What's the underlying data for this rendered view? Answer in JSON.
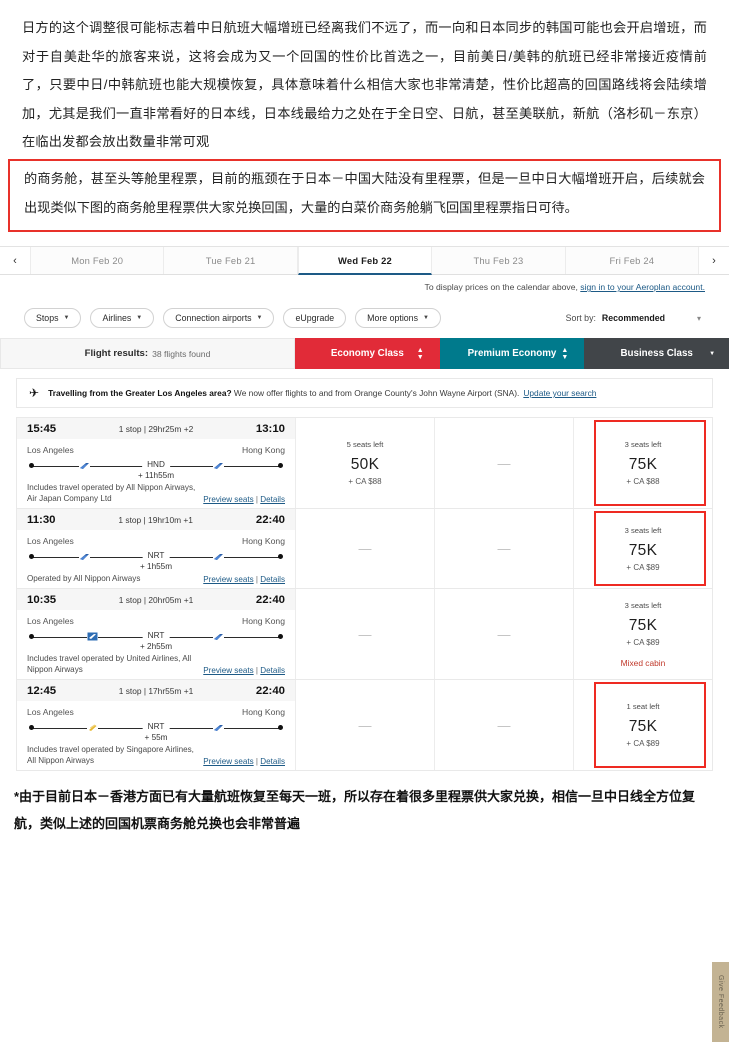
{
  "article": {
    "paragraph": "日方的这个调整很可能标志着中日航班大幅增班已经离我们不远了，而一向和日本同步的韩国可能也会开启增班，而对于自美赴华的旅客来说，这将会成为又一个回国的性价比首选之一，目前美日/美韩的航班已经非常接近疫情前了，只要中日/中韩航班也能大规模恢复，具体意味着什么相信大家也非常清楚，性价比超高的回国路线将会陆续增加，尤其是我们一直非常看好的日本线，日本线最给力之处在于全日空、日航，甚至美联航，新航（洛杉矶－东京）在临出发都会放出数量非常可观",
    "highlight": "的商务舱，甚至头等舱里程票，目前的瓶颈在于日本－中国大陆没有里程票，但是一旦中日大幅增班开启，后续就会出现类似下图的商务舱里程票供大家兑换回国，大量的白菜价商务舱躺飞回国里程票指日可待。",
    "footnote": "*由于目前日本－香港方面已有大量航班恢复至每天一班，所以存在着很多里程票供大家兑换，相信一旦中日线全方位复航，类似上述的回国机票商务舱兑换也会非常普遍"
  },
  "colors": {
    "economy": "#e12b38",
    "premium": "#007a8c",
    "business": "#414549",
    "link": "#1d5a86",
    "highlight_border": "#e8312a",
    "feedback_tab": "#c3b393"
  },
  "datebar": {
    "prev_icon": "‹",
    "next_icon": "›",
    "dates": [
      {
        "label": "Mon Feb 20",
        "active": false
      },
      {
        "label": "Tue Feb 21",
        "active": false
      },
      {
        "label": "Wed Feb 22",
        "active": true
      },
      {
        "label": "Thu Feb 23",
        "active": false
      },
      {
        "label": "Fri Feb 24",
        "active": false
      }
    ],
    "signin_text": "To display prices on the calendar above, ",
    "signin_link": "sign in to your Aeroplan account."
  },
  "filters": {
    "pills": [
      {
        "label": "Stops",
        "caret": true
      },
      {
        "label": "Airlines",
        "caret": true
      },
      {
        "label": "Connection airports",
        "caret": true
      },
      {
        "label": "eUpgrade",
        "caret": false
      },
      {
        "label": "More options",
        "caret": true
      }
    ],
    "sort_label": "Sort by:",
    "sort_value": "Recommended"
  },
  "results": {
    "title": "Flight results:",
    "count_text": "38 flights found",
    "cabins": [
      {
        "label": "Economy Class"
      },
      {
        "label": "Premium Economy"
      },
      {
        "label": "Business Class"
      }
    ]
  },
  "notice": {
    "icon": "airplane-icon",
    "bold": "Travelling from the Greater Los Angeles area?",
    "text": " We now offer flights to and from Orange County's John Wayne Airport (SNA).",
    "link": "Update your search"
  },
  "flights": [
    {
      "depart_time": "15:45",
      "summary": "1 stop | 29hr25m +2",
      "arrive_time": "13:10",
      "origin": "Los Angeles",
      "destination": "Hong Kong",
      "connection": "HND",
      "layover": "+ 11h55m",
      "operated_by": "Includes travel operated by All Nippon Airways, Air Japan Company Ltd",
      "preview_link": "Preview seats",
      "details_link": "Details",
      "economy": {
        "seats": "5 seats left",
        "miles": "50K",
        "cash": "+ CA $88",
        "empty": false,
        "highlight": false,
        "mixed": ""
      },
      "premium": {
        "empty": true,
        "dash": "—"
      },
      "business": {
        "seats": "3 seats left",
        "miles": "75K",
        "cash": "+ CA $88",
        "empty": false,
        "highlight": true,
        "mixed": ""
      }
    },
    {
      "depart_time": "11:30",
      "summary": "1 stop | 19hr10m +1",
      "arrive_time": "22:40",
      "origin": "Los Angeles",
      "destination": "Hong Kong",
      "connection": "NRT",
      "layover": "+ 1h55m",
      "operated_by": "Operated by All Nippon Airways",
      "preview_link": "Preview seats",
      "details_link": "Details",
      "economy": {
        "empty": true,
        "dash": "—"
      },
      "premium": {
        "empty": true,
        "dash": "—"
      },
      "business": {
        "seats": "3 seats left",
        "miles": "75K",
        "cash": "+ CA $89",
        "empty": false,
        "highlight": true,
        "mixed": ""
      }
    },
    {
      "depart_time": "10:35",
      "summary": "1 stop | 20hr05m +1",
      "arrive_time": "22:40",
      "origin": "Los Angeles",
      "destination": "Hong Kong",
      "connection": "NRT",
      "layover": "+ 2h55m",
      "operated_by": "Includes travel operated by United Airlines, All Nippon Airways",
      "preview_link": "Preview seats",
      "details_link": "Details",
      "economy": {
        "empty": true,
        "dash": "—"
      },
      "premium": {
        "empty": true,
        "dash": "—"
      },
      "business": {
        "seats": "3 seats left",
        "miles": "75K",
        "cash": "+ CA $89",
        "empty": false,
        "highlight": false,
        "mixed": "Mixed cabin"
      }
    },
    {
      "depart_time": "12:45",
      "summary": "1 stop | 17hr55m +1",
      "arrive_time": "22:40",
      "origin": "Los Angeles",
      "destination": "Hong Kong",
      "connection": "NRT",
      "layover": "+ 55m",
      "operated_by": "Includes travel operated by Singapore Airlines, All Nippon Airways",
      "preview_link": "Preview seats",
      "details_link": "Details",
      "economy": {
        "empty": true,
        "dash": "—"
      },
      "premium": {
        "empty": true,
        "dash": "—"
      },
      "business": {
        "seats": "1 seat left",
        "miles": "75K",
        "cash": "+ CA $89",
        "empty": false,
        "highlight": true,
        "mixed": ""
      }
    }
  ],
  "feedback": {
    "label": "Give Feedback"
  }
}
